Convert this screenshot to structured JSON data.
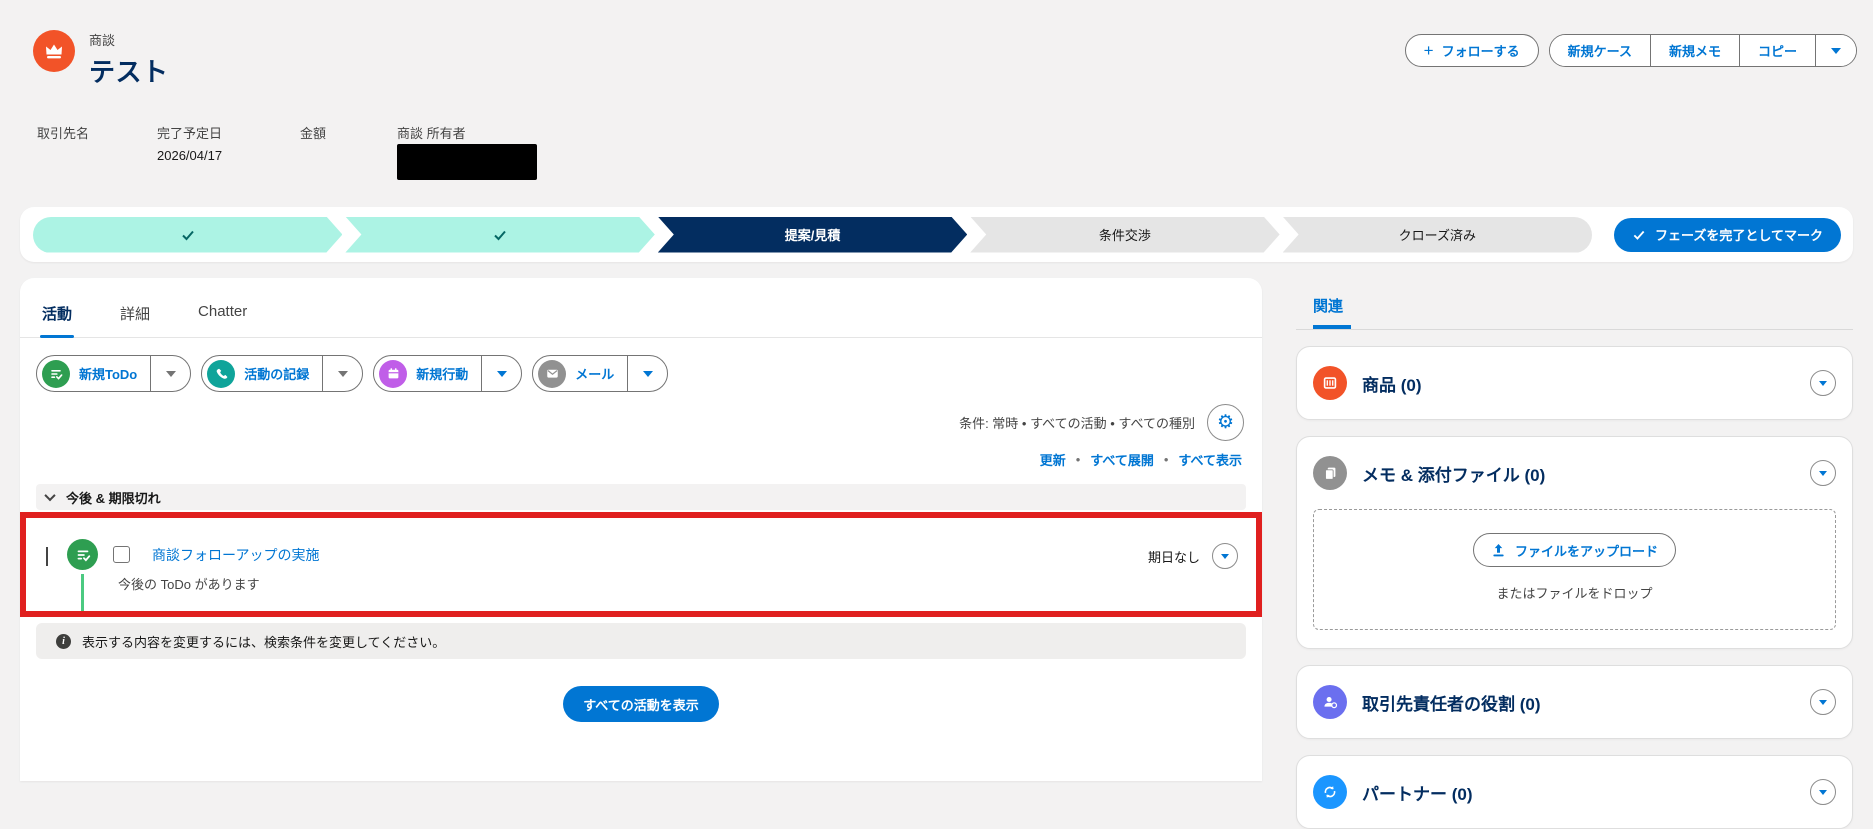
{
  "header": {
    "entity_label": "商談",
    "record_title": "テスト",
    "follow_icon": "+",
    "follow_label": "フォローする",
    "group_buttons": [
      "新規ケース",
      "新規メモ",
      "コピー"
    ],
    "fields": [
      {
        "label": "取引先名",
        "value": ""
      },
      {
        "label": "完了予定日",
        "value": "2026/04/17"
      },
      {
        "label": "金額",
        "value": ""
      },
      {
        "label": "商談 所有者",
        "value": "",
        "redacted": true
      }
    ]
  },
  "path": {
    "stages": [
      {
        "label": "",
        "state": "complete"
      },
      {
        "label": "",
        "state": "complete"
      },
      {
        "label": "提案/見積",
        "state": "current"
      },
      {
        "label": "条件交渉",
        "state": "incomplete"
      },
      {
        "label": "クローズ済み",
        "state": "incomplete"
      }
    ],
    "mark_complete_label": "フェーズを完了としてマーク"
  },
  "main": {
    "tabs": [
      "活動",
      "詳細",
      "Chatter"
    ],
    "active_tab": "活動",
    "composer": [
      {
        "label": "新規ToDo",
        "icon": "task-icon",
        "color": "#2E9E51"
      },
      {
        "label": "活動の記録",
        "icon": "log-a-call-icon",
        "color": "#0FA49A"
      },
      {
        "label": "新規行動",
        "icon": "event-icon",
        "color": "#C05EE8"
      },
      {
        "label": "メール",
        "icon": "email-icon",
        "color": "#919191"
      }
    ],
    "filter_summary": "条件: 常時 • すべての活動 • すべての種別",
    "gear_glyph": "⚙",
    "links": [
      "更新",
      "すべて展開",
      "すべて表示"
    ],
    "link_separator": "•",
    "section_header": "今後 & 期限切れ",
    "task": {
      "title": "商談フォローアップの実施",
      "subtitle": "今後の ToDo があります",
      "due": "期日なし"
    },
    "info_message": "表示する内容を変更するには、検索条件を変更してください。",
    "info_glyph": "i",
    "view_all_label": "すべての活動を表示"
  },
  "sidebar": {
    "tab_label": "関連",
    "cards": [
      {
        "title": "商品",
        "count": "(0)",
        "color": "#F25328"
      },
      {
        "title": "メモ & 添付ファイル",
        "count": "(0)",
        "color": "#919191",
        "upload_label": "ファイルをアップロード",
        "drop_label": "またはファイルをドロップ"
      },
      {
        "title": "取引先責任者の役割",
        "count": "(0)",
        "color": "#6B6FEF"
      },
      {
        "title": "パートナー",
        "count": "(0)",
        "color": "#1B96FF"
      }
    ]
  },
  "colors": {
    "brand_blue": "#0176D3",
    "navy": "#032D60",
    "path_complete": "#ACF3E4",
    "path_complete_check": "#056764",
    "highlight_red": "#E0201F",
    "background": "#F3F2F2"
  }
}
